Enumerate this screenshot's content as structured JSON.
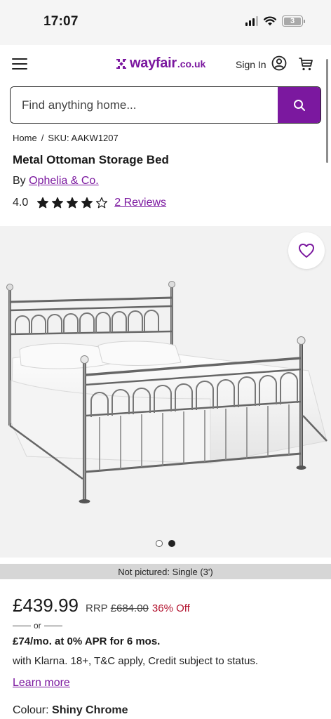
{
  "status_bar": {
    "time": "17:07",
    "battery": "3"
  },
  "header": {
    "logo_text": "wayfair",
    "logo_tld": ".co.uk",
    "sign_in_label": "Sign In",
    "brand_color": "#7b189f"
  },
  "search": {
    "placeholder": "Find anything home..."
  },
  "breadcrumb": {
    "home": "Home",
    "separator": "/",
    "sku": "SKU: AAKW1207"
  },
  "product": {
    "title": "Metal Ottoman Storage Bed",
    "by_prefix": "By",
    "brand": "Ophelia & Co.",
    "rating": "4.0",
    "rating_stars": 4,
    "rating_max": 5,
    "reviews_label": "2 Reviews"
  },
  "gallery": {
    "image_count": 2,
    "active_index": 2,
    "not_pictured": "Not pictured: Single (3')"
  },
  "pricing": {
    "price": "£439.99",
    "rrp_label": "RRP",
    "rrp_value": "£684.00",
    "discount": "36% Off",
    "discount_color": "#b3122e",
    "or_label": "or",
    "finance_headline": "£74/mo. at 0% APR for 6 mos.",
    "finance_detail": "with Klarna. 18+, T&C apply, Credit subject to status.",
    "learn_more": "Learn more"
  },
  "options": {
    "colour_label": "Colour:",
    "colour_value": "Shiny Chrome"
  }
}
